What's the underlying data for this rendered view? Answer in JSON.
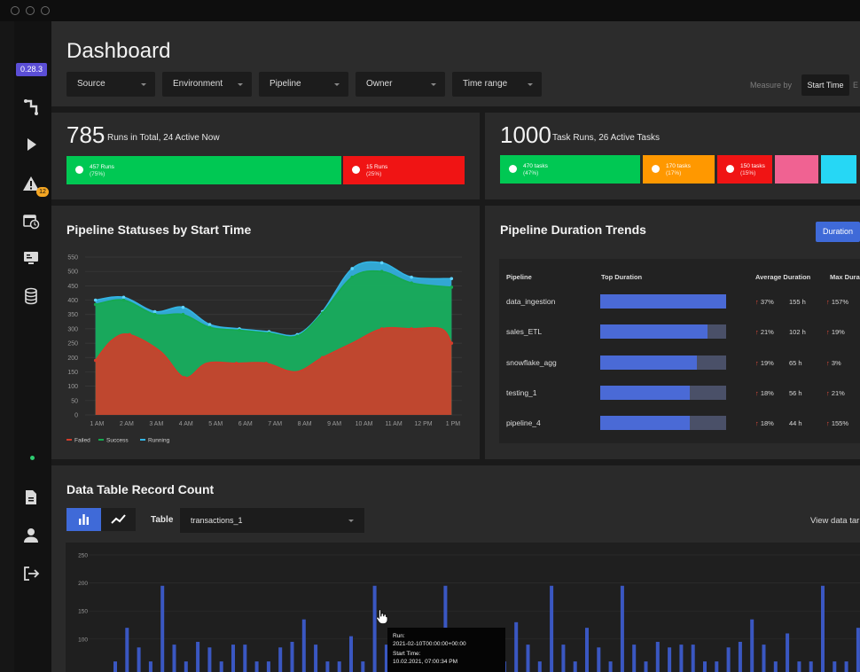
{
  "app": {
    "version": "0.28.3",
    "sidebar_badge": "12",
    "accent": "#3f6ad8"
  },
  "header": {
    "title": "Dashboard",
    "filters": [
      {
        "label": "Source"
      },
      {
        "label": "Environment"
      },
      {
        "label": "Pipeline"
      },
      {
        "label": "Owner"
      },
      {
        "label": "Time range"
      }
    ],
    "measure_label": "Measure by",
    "measure_selected": "Start Time",
    "measure_other": "E"
  },
  "runs": {
    "total": "785",
    "subtitle": "Runs in Total, 24 Active Now",
    "segments": [
      {
        "label": "457 Runs",
        "pct": "(75%)",
        "color": "#00c853",
        "share": 0.7
      },
      {
        "label": "15 Runs",
        "pct": "(25%)",
        "color": "#f01414",
        "share": 0.3
      }
    ]
  },
  "tasks": {
    "total": "1000",
    "subtitle": "Task Runs,  26 Active Tasks",
    "segments": [
      {
        "label": "470 tasks",
        "pct": "(47%)",
        "color": "#00c853"
      },
      {
        "label": "170 tasks",
        "pct": "(17%)",
        "color": "#ff9800"
      },
      {
        "label": "150 tasks",
        "pct": "(15%)",
        "color": "#f01414"
      },
      {
        "label": "",
        "pct": "",
        "color": "#f06292"
      },
      {
        "label": "",
        "pct": "",
        "color": "#26d7f5"
      }
    ]
  },
  "statuses": {
    "title": "Pipeline Statuses by Start Time",
    "legend": [
      "Failed",
      "Success",
      "Running"
    ]
  },
  "chart_data": [
    {
      "type": "area",
      "title": "Pipeline Statuses by Start Time",
      "categories": [
        "1 AM",
        "2 AM",
        "3 AM",
        "4 AM",
        "5 AM",
        "6 AM",
        "7 AM",
        "8 AM",
        "9 AM",
        "10 AM",
        "11 AM",
        "12 PM",
        "1 PM"
      ],
      "x_points": [
        1,
        2,
        3,
        4,
        5,
        6,
        7,
        8,
        9,
        10,
        11,
        12,
        13
      ],
      "ylim": [
        0,
        550
      ],
      "yticks": [
        0,
        50,
        100,
        150,
        200,
        250,
        300,
        350,
        400,
        450,
        500,
        550
      ],
      "series": [
        {
          "name": "Failed",
          "color": "#d23c2a",
          "x": [
            0.95,
            1.5,
            2.1,
            3.15,
            3.95,
            4.7,
            5.7,
            6.7,
            7.7,
            8.6,
            9.6,
            10.6,
            11.6,
            12.6,
            12.95
          ],
          "values": [
            190,
            260,
            280,
            220,
            130,
            180,
            180,
            180,
            150,
            200,
            250,
            300,
            300,
            300,
            250
          ]
        },
        {
          "name": "Success",
          "color": "#16a94f",
          "x": [
            0.95,
            1.9,
            2.95,
            3.9,
            4.8,
            5.8,
            6.8,
            7.75,
            8.6,
            9.6,
            10.6,
            11.6,
            12.95
          ],
          "values": [
            385,
            400,
            350,
            350,
            305,
            295,
            285,
            275,
            355,
            480,
            500,
            460,
            445
          ]
        },
        {
          "name": "Running",
          "color": "#33b5e5",
          "x": [
            0.95,
            1.9,
            2.95,
            3.9,
            4.8,
            5.8,
            6.8,
            7.75,
            8.6,
            9.6,
            10.6,
            11.6,
            12.95
          ],
          "values": [
            400,
            410,
            360,
            375,
            315,
            300,
            290,
            280,
            360,
            510,
            530,
            480,
            475
          ]
        }
      ]
    },
    {
      "type": "bar",
      "title": "Data Table Record Count",
      "ylim": [
        0,
        250
      ],
      "yticks": [
        100,
        150,
        200,
        250
      ],
      "values": [
        60,
        120,
        85,
        60,
        195,
        90,
        60,
        95,
        85,
        60,
        90,
        90,
        60,
        60,
        85,
        95,
        135,
        90,
        60,
        60,
        105,
        60,
        195,
        90,
        60,
        120,
        90,
        60,
        195,
        60,
        60,
        60,
        60,
        60,
        130,
        90,
        60,
        195,
        90,
        60,
        120,
        85,
        60,
        195,
        90,
        60,
        95,
        85,
        90,
        90,
        60,
        60,
        85,
        95,
        135,
        90,
        60,
        110,
        60,
        60,
        195,
        60,
        60,
        120,
        85,
        60,
        195
      ],
      "highlight_index": 29,
      "bar_color": "#3a57c2",
      "highlight_color": "#56c8f0"
    }
  ],
  "trends": {
    "title": "Pipeline Duration Trends",
    "button": "Duration",
    "columns": [
      "Pipeline",
      "Top Duration",
      "Average Duration",
      "Max Dura"
    ],
    "rows": [
      {
        "name": "data_ingestion",
        "fill": 1.0,
        "avg_pct": "37%",
        "avg": "155 h",
        "max_pct": "157%"
      },
      {
        "name": "sales_ETL",
        "fill": 0.85,
        "avg_pct": "21%",
        "avg": "102 h",
        "max_pct": "19%"
      },
      {
        "name": "snowflake_agg",
        "fill": 0.77,
        "avg_pct": "19%",
        "avg": "65 h",
        "max_pct": "3%"
      },
      {
        "name": "testing_1",
        "fill": 0.71,
        "avg_pct": "18%",
        "avg": "56 h",
        "max_pct": "21%"
      },
      {
        "name": "pipeline_4",
        "fill": 0.71,
        "avg_pct": "18%",
        "avg": "44 h",
        "max_pct": "155%"
      }
    ]
  },
  "records": {
    "title": "Data Table Record Count",
    "table_label": "Table",
    "table_value": "transactions_1",
    "view_link": "View data tar",
    "tooltip": {
      "run_label": "Run:",
      "run_value": "2021-02-10T00:00:00+00:00",
      "start_label": "Start Time:",
      "start_value": "10.02.2021, 07:00:34 PM"
    }
  }
}
